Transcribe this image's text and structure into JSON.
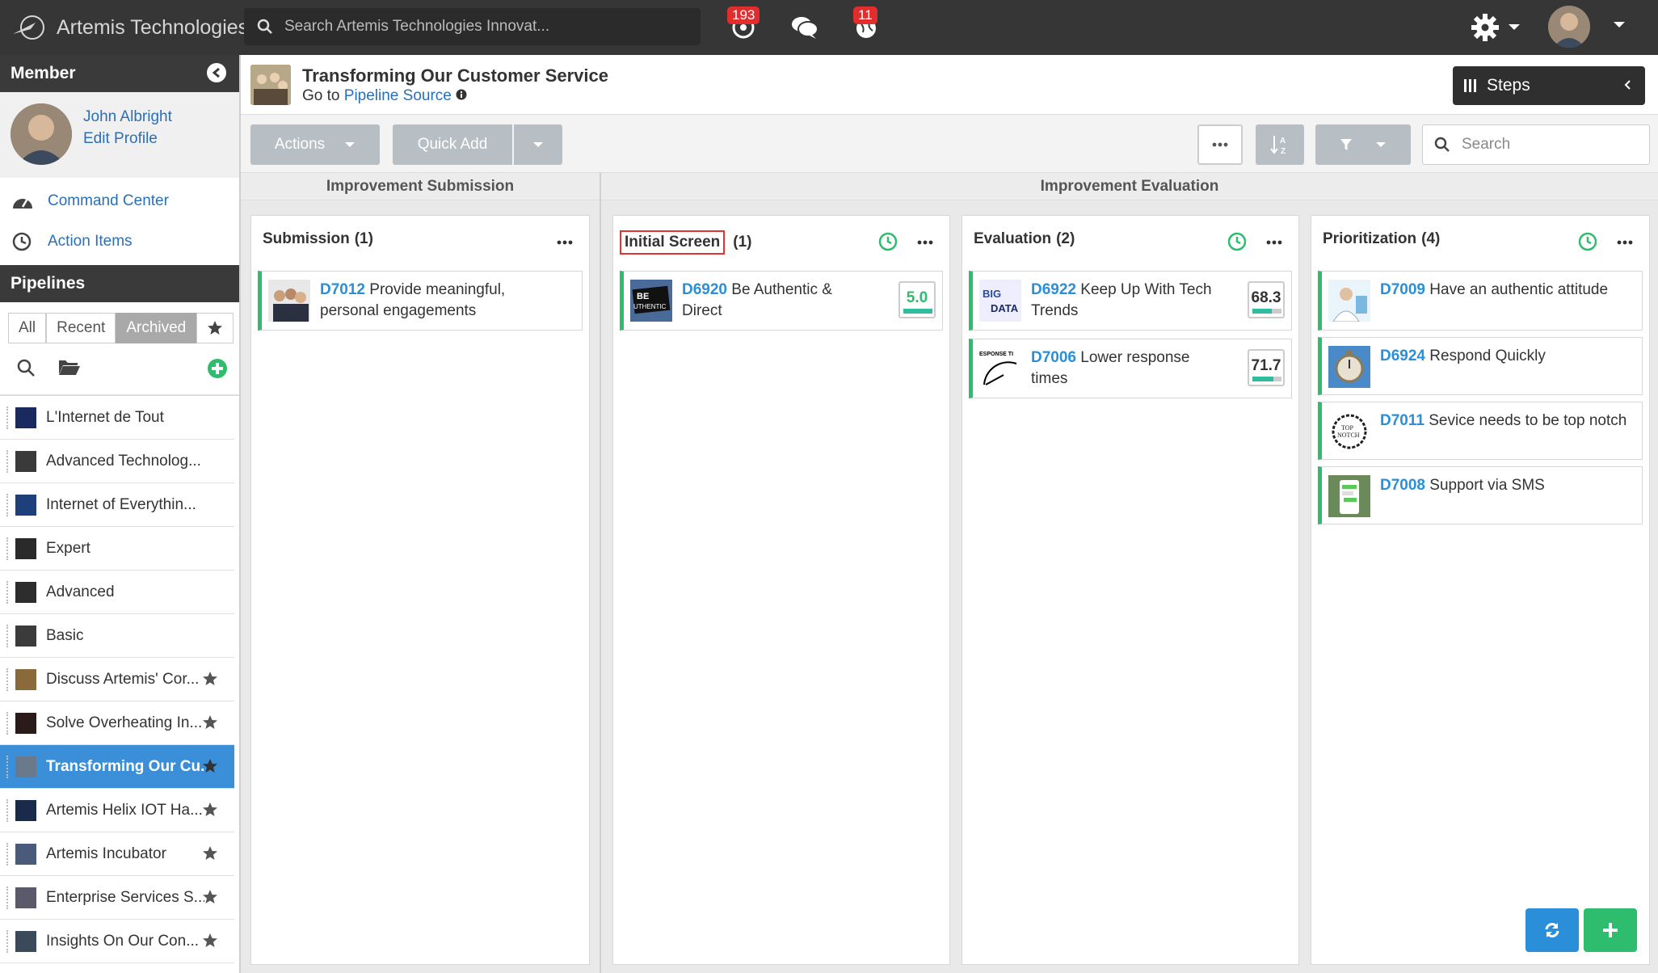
{
  "app": {
    "brand": "Artemis Technologies",
    "search_placeholder": "Search Artemis Technologies Innovat...",
    "notifications_count": "193",
    "alerts_count": "11"
  },
  "sidebar": {
    "member_title": "Member",
    "user_name": "John Albright",
    "edit_profile": "Edit Profile",
    "command_center": "Command Center",
    "action_items": "Action Items",
    "pipelines_title": "Pipelines",
    "tabs": [
      "All",
      "Recent",
      "Archived"
    ],
    "active_tab": "Archived",
    "pipelines": [
      {
        "name": "L'Internet de Tout",
        "starred": false
      },
      {
        "name": "Advanced Technolog...",
        "starred": false
      },
      {
        "name": "Internet of Everythin...",
        "starred": false
      },
      {
        "name": "Expert",
        "starred": false
      },
      {
        "name": "Advanced",
        "starred": false
      },
      {
        "name": "Basic",
        "starred": false
      },
      {
        "name": "Discuss Artemis' Cor...",
        "starred": true
      },
      {
        "name": "Solve Overheating In...",
        "starred": true
      },
      {
        "name": "Transforming Our Cu...",
        "starred": true,
        "selected": true
      },
      {
        "name": "Artemis Helix IOT Ha...",
        "starred": true
      },
      {
        "name": "Artemis Incubator",
        "starred": true
      },
      {
        "name": "Enterprise Services S...",
        "starred": true
      },
      {
        "name": "Insights On Our Con...",
        "starred": true
      }
    ]
  },
  "header": {
    "title": "Transforming Our Customer Service",
    "goto_prefix": "Go to",
    "goto_link": "Pipeline Source",
    "steps_label": "Steps"
  },
  "toolbar": {
    "actions_label": "Actions",
    "quick_add_label": "Quick Add",
    "search_placeholder": "Search"
  },
  "groups": {
    "submission": "Improvement Submission",
    "evaluation": "Improvement Evaluation"
  },
  "columns": [
    {
      "title": "Submission",
      "count": "(1)",
      "cards": [
        {
          "id": "D7012",
          "text": "Provide meaningful,",
          "text2": "personal engagements",
          "score": null
        }
      ]
    },
    {
      "title": "Initial Screen",
      "count": "(1)",
      "cards": [
        {
          "id": "D6920",
          "text": "Be Authentic &",
          "text2": "Direct",
          "score": "5.0",
          "score_pct": 0.5
        }
      ]
    },
    {
      "title": "Evaluation",
      "count": "(2)",
      "cards": [
        {
          "id": "D6922",
          "text": "Keep Up With Tech",
          "text2": "Trends",
          "score": "68.3",
          "score_pct": 0.68
        },
        {
          "id": "D7006",
          "text": "Lower response",
          "text2": "times",
          "score": "71.7",
          "score_pct": 0.72
        }
      ]
    },
    {
      "title": "Prioritization",
      "count": "(4)",
      "cards": [
        {
          "id": "D7009",
          "text": "Have an authentic attitude",
          "text2": "",
          "score": null
        },
        {
          "id": "D6924",
          "text": "Respond Quickly",
          "text2": "",
          "score": null
        },
        {
          "id": "D7011",
          "text": "Sevice needs to be top notch",
          "text2": "",
          "score": null
        },
        {
          "id": "D7008",
          "text": "Support via SMS",
          "text2": "",
          "score": null
        }
      ]
    }
  ],
  "thumb_texts": {
    "be_authentic": "BE",
    "be_authentic_2": "UTHENTIC",
    "big_data": "BIG",
    "big_data_2": "DATA",
    "response": "ESPONSE TI",
    "top_notch": "TOP",
    "top_notch_2": "NOTCH"
  },
  "colors": {
    "accent": "#2a8fd8",
    "green": "#2ebd6e",
    "selected": "#3a8fd8",
    "badge": "#e02d2d"
  }
}
